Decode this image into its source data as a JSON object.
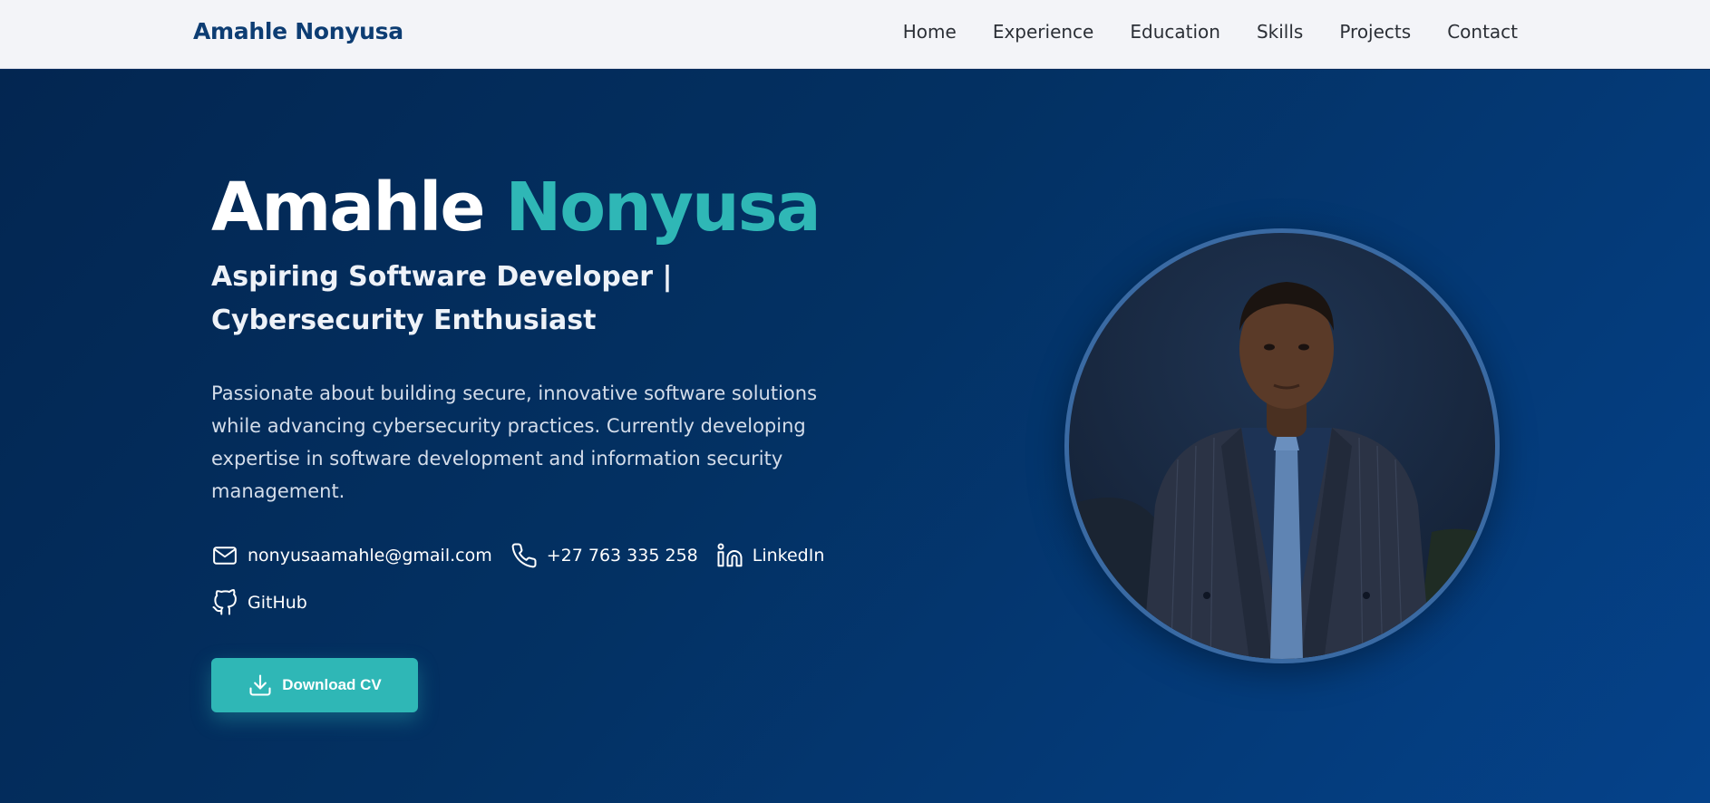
{
  "navbar": {
    "brand": "Amahle Nonyusa",
    "links": [
      "Home",
      "Experience",
      "Education",
      "Skills",
      "Projects",
      "Contact"
    ]
  },
  "hero": {
    "first_name": "Amahle",
    "last_name": "Nonyusa",
    "subtitle": "Aspiring Software Developer | Cybersecurity Enthusiast",
    "description": "Passionate about building secure, innovative software solutions while advancing cybersecurity practices. Currently developing expertise in software development and information security management.",
    "contacts": {
      "email": "nonyusaamahle@gmail.com",
      "phone": "+27 763 335 258",
      "linkedin": "LinkedIn",
      "github": "GitHub"
    },
    "cv_button": "Download CV"
  },
  "icons": {
    "email": "mail-icon",
    "phone": "phone-icon",
    "linkedin": "linkedin-icon",
    "github": "github-icon",
    "download": "download-icon"
  },
  "colors": {
    "accent": "#2fb7b6",
    "brand": "#0d3d73",
    "hero_bg": "#033163",
    "nav_bg": "#f3f4f8"
  }
}
